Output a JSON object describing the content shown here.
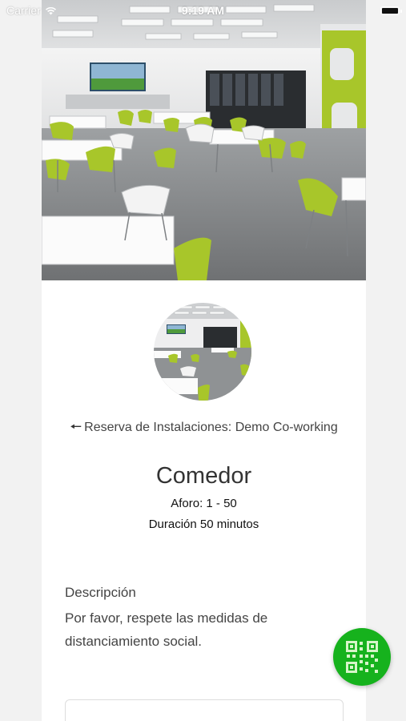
{
  "status_bar": {
    "carrier": "Carrier",
    "time": "9:19 AM"
  },
  "facility": {
    "back_label": "Reserva de Instalaciones: Demo Co-working",
    "name": "Comedor",
    "capacity": "Aforo: 1 - 50",
    "duration": "Duración 50 minutos"
  },
  "description": {
    "heading": "Descripción",
    "text": "Por favor, respete las medidas de distanciamiento social."
  },
  "colors": {
    "fab": "#16b21d",
    "chair_accent": "#a8c62a"
  },
  "icons": {
    "back": "arrow-left-icon",
    "fab": "qr-code-icon",
    "wifi": "wifi-icon",
    "battery": "battery-icon"
  }
}
